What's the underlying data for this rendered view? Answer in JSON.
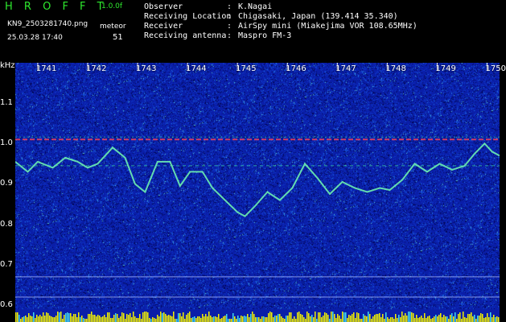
{
  "header": {
    "app_name": "H R O F F T",
    "version": "1.0.0f",
    "filename": "KN9_2503281740.png",
    "datetime": "25.03.28 17:40",
    "meteor_label": "meteor",
    "meteor_count": "51",
    "info": [
      {
        "label": "Observer",
        "value": "K.Nagai"
      },
      {
        "label": "Receiving Location",
        "value": "Chigasaki, Japan (139.414 35.340)"
      },
      {
        "label": "Receiver",
        "value": "AirSpy mini (Miakejima VOR 108.65MHz)"
      },
      {
        "label": "Receiving antenna",
        "value": "Maspro FM-3"
      }
    ],
    "separator": ":"
  },
  "colors": {
    "background": "#000000",
    "noise": "#0a1ea8",
    "trace": "#6df0b0",
    "carrier_line": "#e04060",
    "baseline": "#f2f000",
    "logo": "#2ee82e"
  },
  "chart_data": {
    "type": "heatmap",
    "y_unit_label": "kHz",
    "yticks": [
      "1.1",
      "1.0",
      "0.9",
      "0.8",
      "0.7",
      "0.6"
    ],
    "ylim": [
      0.59,
      1.2
    ],
    "xticks": [
      "1741",
      "1742",
      "1743",
      "1744",
      "1745",
      "1746",
      "1747",
      "1748",
      "1749",
      "1750"
    ],
    "xlim": [
      1740.55,
      1750.25
    ],
    "carrier_freq": 1.01,
    "horizontal_lines": [
      0.945,
      0.67,
      0.62
    ],
    "trace": {
      "x": [
        1740.55,
        1740.8,
        1741.0,
        1741.3,
        1741.55,
        1741.8,
        1742.0,
        1742.2,
        1742.5,
        1742.75,
        1742.95,
        1743.15,
        1743.4,
        1743.65,
        1743.85,
        1744.05,
        1744.3,
        1744.5,
        1744.75,
        1745.0,
        1745.15,
        1745.35,
        1745.6,
        1745.85,
        1746.1,
        1746.35,
        1746.6,
        1746.85,
        1747.1,
        1747.35,
        1747.6,
        1747.85,
        1748.05,
        1748.3,
        1748.55,
        1748.8,
        1749.05,
        1749.3,
        1749.55,
        1749.75,
        1749.95,
        1750.1,
        1750.25
      ],
      "y": [
        0.955,
        0.93,
        0.955,
        0.94,
        0.965,
        0.955,
        0.94,
        0.95,
        0.99,
        0.965,
        0.9,
        0.88,
        0.955,
        0.955,
        0.895,
        0.93,
        0.93,
        0.89,
        0.86,
        0.83,
        0.82,
        0.845,
        0.88,
        0.86,
        0.89,
        0.95,
        0.915,
        0.875,
        0.905,
        0.89,
        0.88,
        0.89,
        0.885,
        0.91,
        0.95,
        0.93,
        0.95,
        0.935,
        0.945,
        0.975,
        1.0,
        0.98,
        0.97
      ]
    }
  }
}
